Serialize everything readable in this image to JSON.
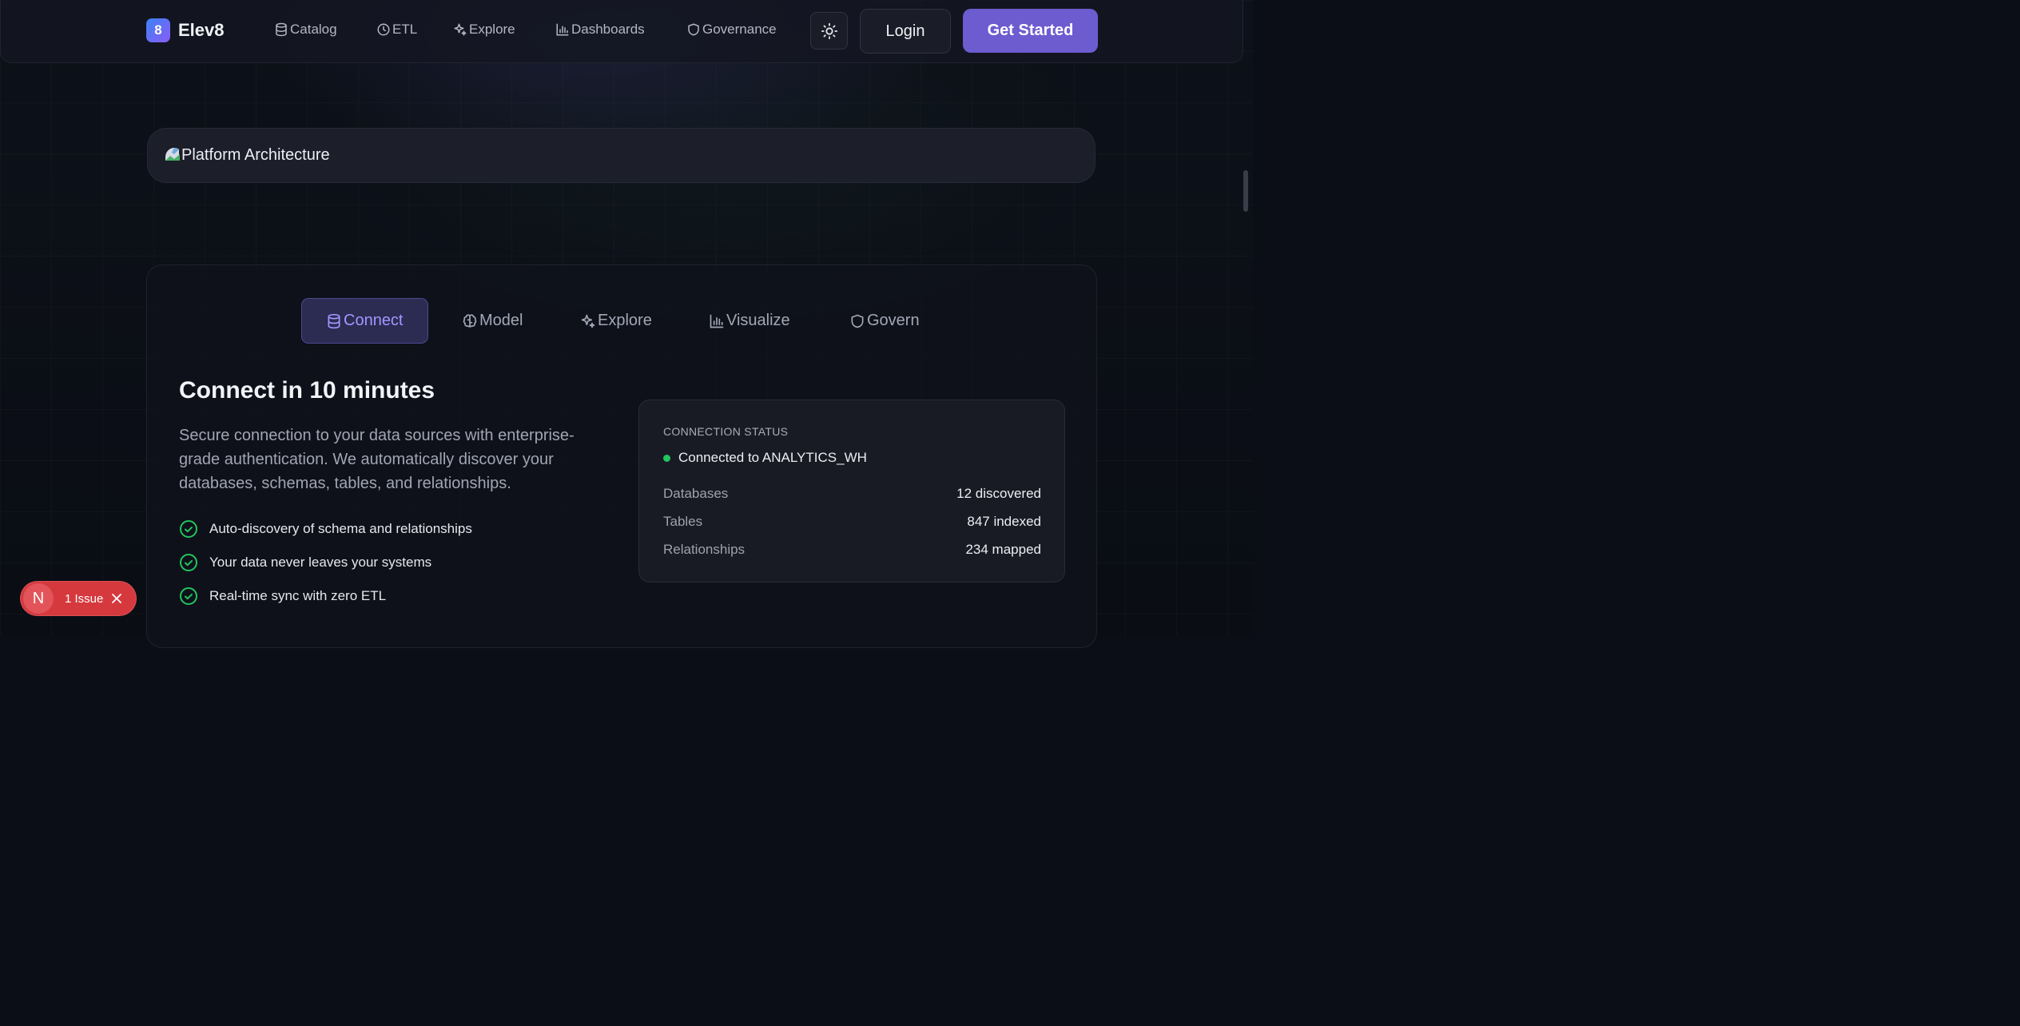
{
  "brand": {
    "name": "Elev8",
    "logo_glyph": "8"
  },
  "nav": {
    "items": [
      {
        "label": "Catalog",
        "icon": "database-icon"
      },
      {
        "label": "ETL",
        "icon": "clock-icon"
      },
      {
        "label": "Explore",
        "icon": "sparkles-icon"
      },
      {
        "label": "Dashboards",
        "icon": "bar-chart-icon"
      },
      {
        "label": "Governance",
        "icon": "shield-icon"
      }
    ],
    "theme_toggle_icon": "sun-icon",
    "login_label": "Login",
    "cta_label": "Get Started"
  },
  "hero_image": {
    "alt_text": "Platform Architecture"
  },
  "features_section": {
    "tabs": [
      {
        "label": "Connect",
        "icon": "database-icon",
        "active": true
      },
      {
        "label": "Model",
        "icon": "brain-icon",
        "active": false
      },
      {
        "label": "Explore",
        "icon": "sparkles-icon",
        "active": false
      },
      {
        "label": "Visualize",
        "icon": "bar-chart-icon",
        "active": false
      },
      {
        "label": "Govern",
        "icon": "shield-icon",
        "active": false
      }
    ],
    "heading": "Connect in 10 minutes",
    "description": "Secure connection to your data sources with enterprise-grade authentication. We automatically discover your databases, schemas, tables, and relationships.",
    "bullets": [
      "Auto-discovery of schema and relationships",
      "Your data never leaves your systems",
      "Real-time sync with zero ETL"
    ],
    "status": {
      "label": "CONNECTION STATUS",
      "connection": "Connected to ANALYTICS_WH",
      "rows": [
        {
          "key": "Databases",
          "value": "12 discovered"
        },
        {
          "key": "Tables",
          "value": "847 indexed"
        },
        {
          "key": "Relationships",
          "value": "234 mapped"
        }
      ]
    }
  },
  "issue_badge": {
    "letter": "N",
    "label": "1 Issue"
  },
  "colors": {
    "accent": "#6d5bd0",
    "accent_text": "#a595ff",
    "success": "#22c55e",
    "danger": "#d5393e"
  }
}
